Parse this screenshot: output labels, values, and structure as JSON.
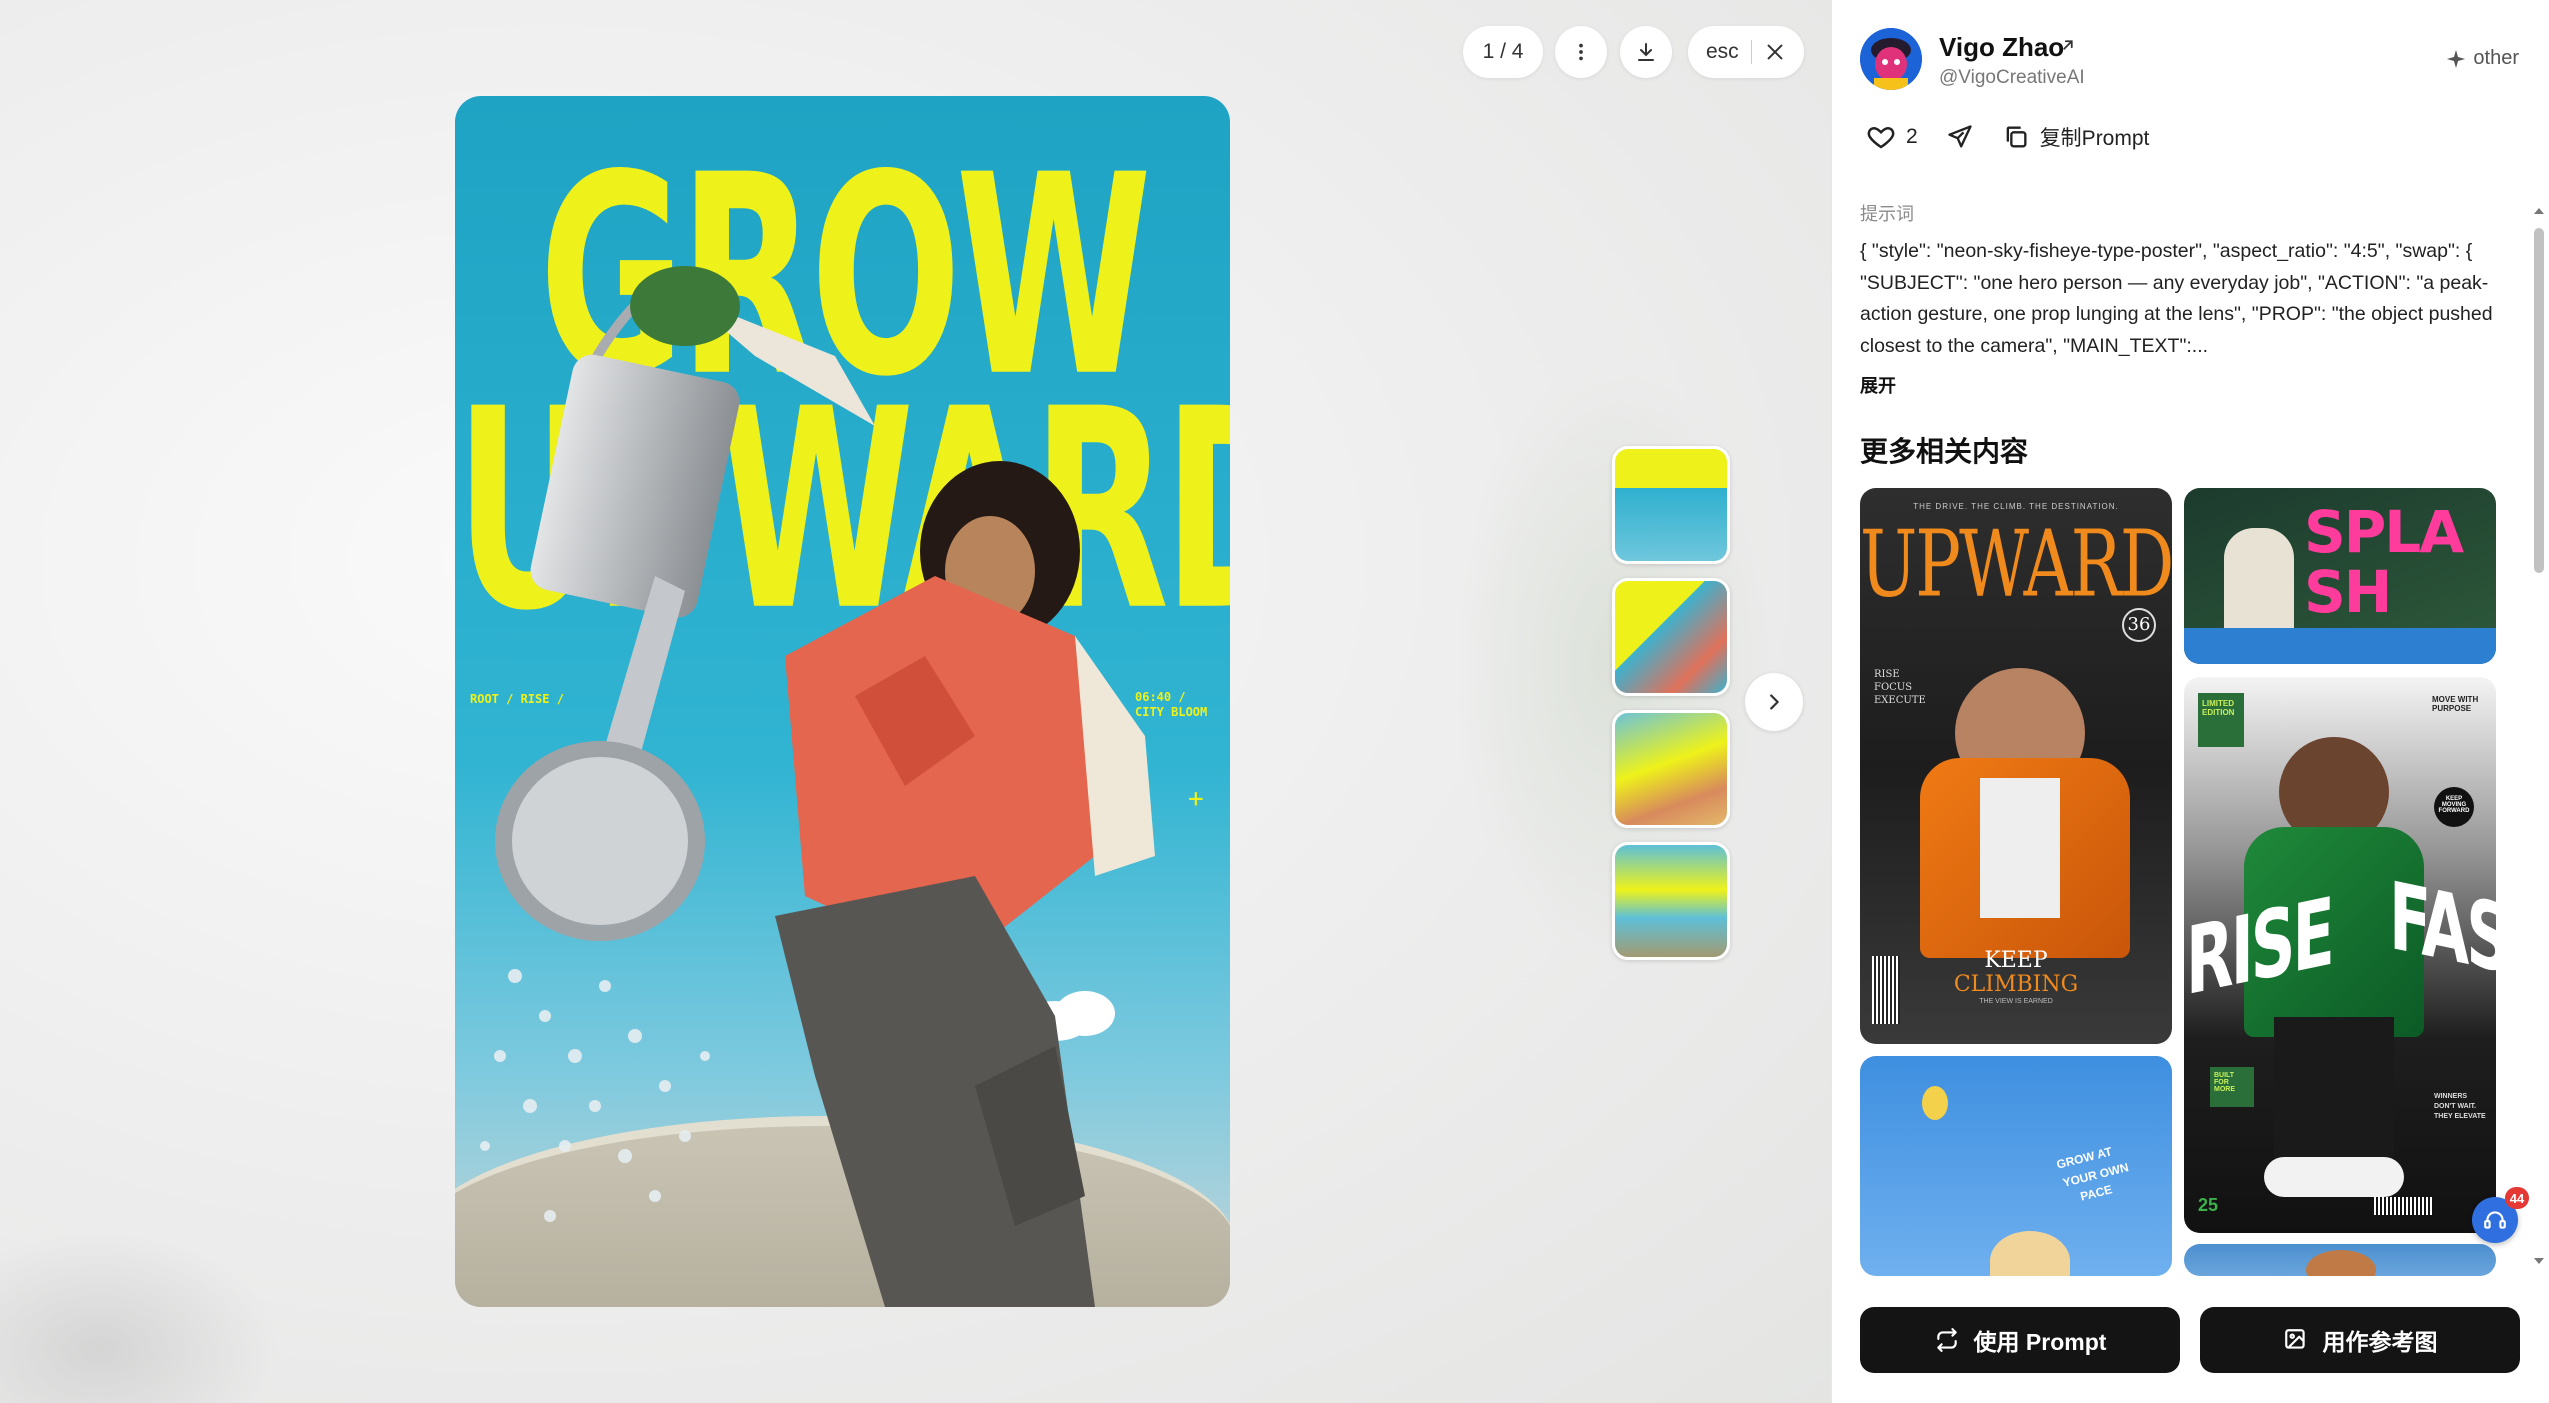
{
  "viewer": {
    "counter": "1 / 4",
    "esc_label": "esc",
    "poster_texts": {
      "line1": "GROW",
      "line2": "UPWARD",
      "left_tag": "ROOT / RISE /",
      "right_tag_1": "06:40 /",
      "right_tag_2": "CITY BLOOM",
      "plus": "+"
    }
  },
  "author": {
    "name": "Vigo Zhao",
    "handle": "@VigoCreativeAI",
    "category": "other"
  },
  "actions": {
    "likes": "2",
    "copy_label": "复制Prompt"
  },
  "prompt": {
    "label": "提示词",
    "text": "{ \"style\": \"neon-sky-fisheye-type-poster\", \"aspect_ratio\": \"4:5\", \"swap\": { \"SUBJECT\": \"one hero person — any everyday job\", \"ACTION\": \"a peak-action gesture, one prop lunging at the lens\", \"PROP\": \"the object pushed closest to the camera\", \"MAIN_TEXT\":...",
    "expand": "展开"
  },
  "related": {
    "title": "更多相关内容",
    "cards": [
      {
        "title": "UPWARD",
        "top": "THE DRIVE. THE CLIMB. THE DESTINATION.",
        "issue": "36",
        "side": "RISE FOCUS EXECUTE",
        "bottom1": "KEEP",
        "bottom2": "CLIMBING",
        "bottom3": "THE VIEW IS EARNED"
      },
      {
        "title": "SPLASH"
      },
      {
        "title_left": "RISE",
        "title_right": "FAST",
        "tag1": "LIMITED EDITION",
        "tag2": "MOVE WITH PURPOSE",
        "tag3": "KEEP MOVING FORWARD",
        "tag4": "BUILT FOR MORE",
        "tag5": "WINNERS DON'T WAIT. THEY ELEVATE",
        "num": "25"
      },
      {
        "text1": "GROW AT",
        "text2": "YOUR OWN",
        "text3": "PACE"
      }
    ]
  },
  "badge_count": "44",
  "buttons": {
    "use_prompt": "使用 Prompt",
    "use_reference": "用作参考图"
  },
  "colors": {
    "poster_yellow": "#eef21a",
    "sky_blue": "#1fa3c4",
    "button_dark": "#141414",
    "badge_red": "#e53935"
  }
}
